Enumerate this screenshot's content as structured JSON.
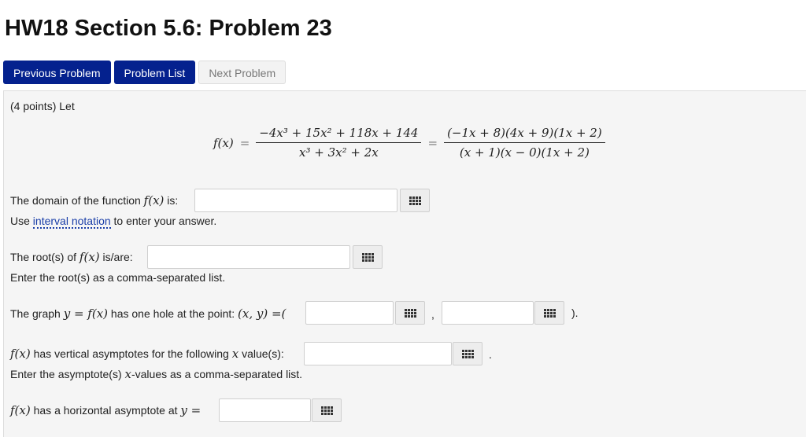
{
  "page": {
    "title": "HW18 Section 5.6: Problem 23"
  },
  "nav": {
    "previous": "Previous Problem",
    "list": "Problem List",
    "next": "Next Problem"
  },
  "problem": {
    "intro": "(4 points) Let",
    "formula": {
      "lhs": "f(x)",
      "frac1_num": "−4x³ + 15x² + 118x + 144",
      "frac1_den": "x³ + 3x² + 2x",
      "frac2_num": "(−1x + 8)(4x + 9)(1x + 2)",
      "frac2_den": "(x + 1)(x − 0)(1x + 2)"
    },
    "q1": {
      "prefix": "The domain of the function ",
      "math": "f(x)",
      "suffix": " is:",
      "hint_prefix": "Use ",
      "hint_link": "interval notation",
      "hint_suffix": " to enter your answer."
    },
    "q2": {
      "prefix": "The root(s) of ",
      "math": "f(x)",
      "suffix": " is/are:",
      "hint": "Enter the root(s) as a comma-separated list."
    },
    "q3": {
      "prefix": "The graph ",
      "math": "y = f(x)",
      "middle": " has one hole at the point: ",
      "math2": "(x, y)",
      "eq": " =(",
      "comma": ",",
      "close": ")."
    },
    "q4": {
      "math": "f(x)",
      "text": " has vertical asymptotes for the following ",
      "math2": "x",
      "suffix": " value(s):",
      "dot": ".",
      "hint_prefix": "Enter the asymptote(s) ",
      "hint_math": "x",
      "hint_suffix": "-values as a comma-separated list."
    },
    "q5": {
      "math": "f(x)",
      "text": " has a horizontal asymptote at ",
      "math2": "y ="
    }
  },
  "icons": {
    "math_editor": "grid-icon"
  }
}
